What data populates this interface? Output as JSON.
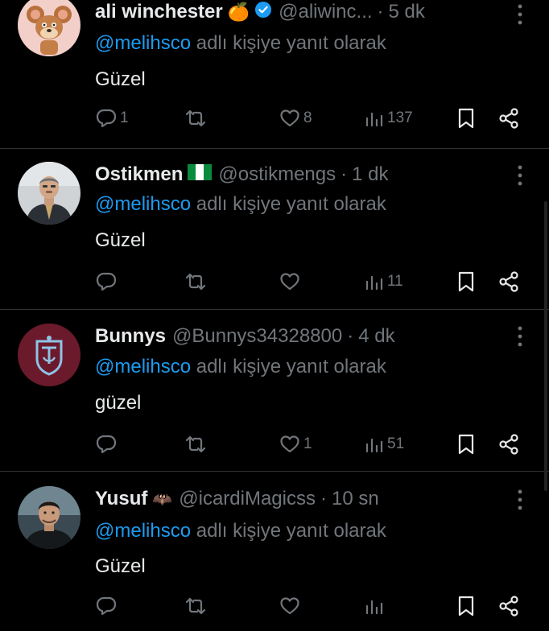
{
  "colors": {
    "background": "#000000",
    "text": "#e7e9ea",
    "muted": "#71767b",
    "mention": "#1d9bf0",
    "divider": "#2f3336",
    "verified": "#1d9bf0"
  },
  "tweets": [
    {
      "name": "ali winchester",
      "emoji": "🍊",
      "verified": true,
      "handle": "@aliwinc...",
      "separator": "·",
      "time": "5 dk",
      "reply_prefix": "@melihsco",
      "reply_suffix": " adlı kişiye yanıt olarak",
      "text": "Güzel",
      "avatar_icon": "cartoon-mouse-avatar",
      "actions": {
        "replies": "1",
        "retweets": "",
        "likes": "8",
        "views": "137"
      }
    },
    {
      "name": "Ostikmen",
      "emoji": "🇳🇬",
      "verified": false,
      "handle": "@ostikmengs",
      "separator": "·",
      "time": "1 dk",
      "reply_prefix": "@melihsco",
      "reply_suffix": " adlı kişiye yanıt olarak",
      "text": "Güzel",
      "avatar_icon": "man-in-suit-avatar",
      "actions": {
        "replies": "",
        "retweets": "",
        "likes": "",
        "views": "11"
      }
    },
    {
      "name": "Bunnys",
      "emoji": "",
      "verified": false,
      "handle": "@Bunnys34328800",
      "separator": "·",
      "time": "4 dk",
      "reply_prefix": "@melihsco",
      "reply_suffix": " adlı kişiye yanıt olarak",
      "text": "güzel",
      "avatar_icon": "trabzonspor-logo-avatar",
      "actions": {
        "replies": "",
        "retweets": "",
        "likes": "1",
        "views": "51"
      }
    },
    {
      "name": "Yusuf",
      "emoji": "🦇",
      "verified": false,
      "handle": "@icardiMagicss",
      "separator": "·",
      "time": "10 sn",
      "reply_prefix": "@melihsco",
      "reply_suffix": " adlı kişiye yanıt olarak",
      "text": "Güzel",
      "avatar_icon": "football-player-avatar",
      "actions": {
        "replies": "",
        "retweets": "",
        "likes": "",
        "views": ""
      }
    }
  ]
}
